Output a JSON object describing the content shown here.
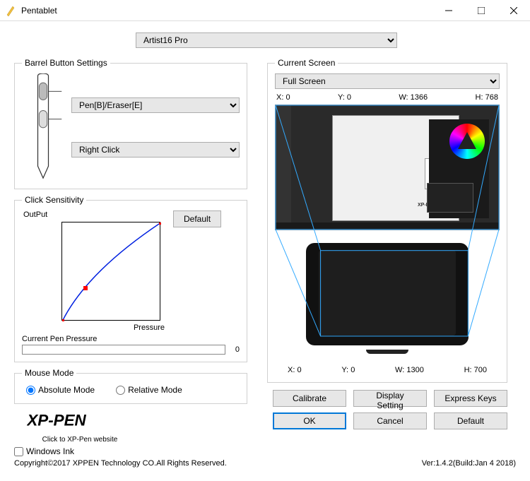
{
  "window": {
    "title": "Pentablet"
  },
  "device": {
    "selected": "Artist16 Pro"
  },
  "barrel": {
    "legend": "Barrel Button Settings",
    "button1": "Pen[B]/Eraser[E]",
    "button2": "Right Click"
  },
  "sensitivity": {
    "legend": "Click Sensitivity",
    "output_label": "OutPut",
    "pressure_label": "Pressure",
    "default_button": "Default",
    "current_label": "Current Pen Pressure",
    "current_value": "0"
  },
  "mouse": {
    "legend": "Mouse Mode",
    "absolute": "Absolute Mode",
    "relative": "Relative Mode"
  },
  "logo_sub": "Click to XP-Pen website",
  "screen": {
    "legend": "Current Screen",
    "selected": "Full Screen",
    "x_label": "X:",
    "x_val": "0",
    "y_label": "Y:",
    "y_val": "0",
    "w_label": "W:",
    "w_val": "1366",
    "h_label": "H:",
    "h_val": "768",
    "tx_label": "X:",
    "tx_val": "0",
    "ty_label": "Y:",
    "ty_val": "0",
    "tw_label": "W:",
    "tw_val": "1300",
    "th_label": "H:",
    "th_val": "700"
  },
  "buttons": {
    "calibrate": "Calibrate",
    "display": "Display Setting",
    "express": "Express Keys",
    "ok": "OK",
    "cancel": "Cancel",
    "default": "Default"
  },
  "windows_ink": "Windows Ink",
  "footer": {
    "copyright": "Copyright©2017 XPPEN Technology CO.All Rights Reserved.",
    "version": "Ver:1.4.2(Build:Jan  4 2018)"
  }
}
